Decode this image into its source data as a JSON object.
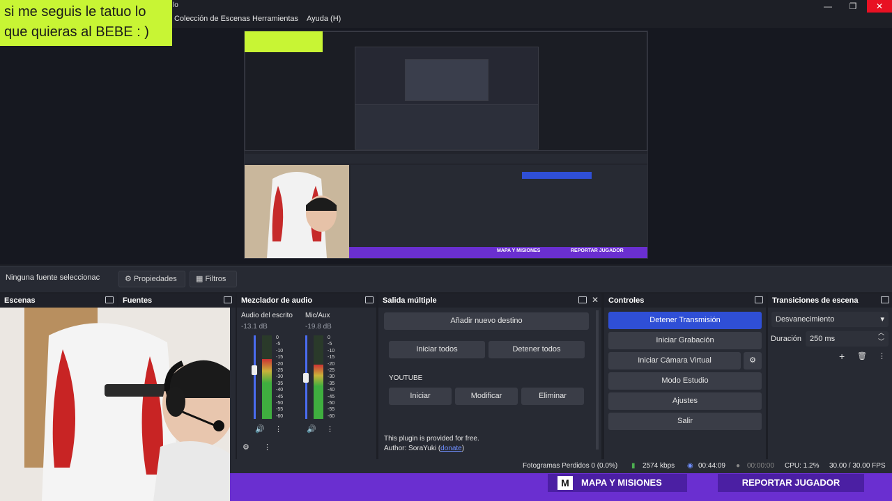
{
  "overlay": {
    "text": "si me seguis le tatuo lo\nque quieras al BEBE : )"
  },
  "window": {
    "title_fragment": "lo",
    "minimize": "—",
    "maximize": "❐",
    "close": "✕"
  },
  "menu": {
    "items": [
      "Colección de Escenas",
      "Herramientas",
      "Ayuda (H)"
    ]
  },
  "preview": {
    "banner_left": "MAPA Y MISIONES",
    "banner_right": "REPORTAR JUGADOR"
  },
  "source_bar": {
    "no_source": "Ninguna fuente seleccionac",
    "properties": "Propiedades",
    "filters": "Filtros"
  },
  "docks": {
    "scenes": "Escenas",
    "sources": "Fuentes",
    "mixer": "Mezclador de audio",
    "multi_output": "Salida múltiple",
    "controls": "Controles",
    "transitions": "Transiciones de escena"
  },
  "mixer": {
    "channels": [
      {
        "name": "Audio del escrito",
        "db": "-13.1 dB",
        "level": 0.72
      },
      {
        "name": "Mic/Aux",
        "db": "-19.8 dB",
        "level": 0.65
      }
    ],
    "ticks": [
      "0",
      "-5",
      "-10",
      "-15",
      "-20",
      "-25",
      "-30",
      "-35",
      "-40",
      "-45",
      "-50",
      "-55",
      "-60"
    ]
  },
  "multi_output": {
    "add_target": "Añadir nuevo destino",
    "start_all": "Iniciar todos",
    "stop_all": "Detener todos",
    "target_name": "YOUTUBE",
    "start": "Iniciar",
    "modify": "Modificar",
    "delete": "Eliminar",
    "footer_line1": "This plugin is provided for free.",
    "footer_line2_prefix": "Author: SoraYuki (",
    "footer_link": "donate",
    "footer_line2_suffix": ")"
  },
  "controls": {
    "stop_stream": "Detener Transmisión",
    "start_recording": "Iniciar Grabación",
    "start_virtual_cam": "Iniciar Cámara Virtual",
    "studio_mode": "Modo Estudio",
    "settings": "Ajustes",
    "exit": "Salir"
  },
  "transitions": {
    "selected": "Desvanecimiento",
    "duration_label": "Duración",
    "duration_value": "250 ms"
  },
  "status": {
    "dropped": "Fotogramas Perdidos 0 (0.0%)",
    "bitrate": "2574 kbps",
    "stream_time": "00:44:09",
    "rec_time": "00:00:00",
    "cpu": "CPU: 1.2%",
    "fps": "30.00 / 30.00 FPS"
  },
  "colors": {
    "accent": "#2f4fd6",
    "banner": "#6a2fd0",
    "overlay": "#c8f534"
  }
}
